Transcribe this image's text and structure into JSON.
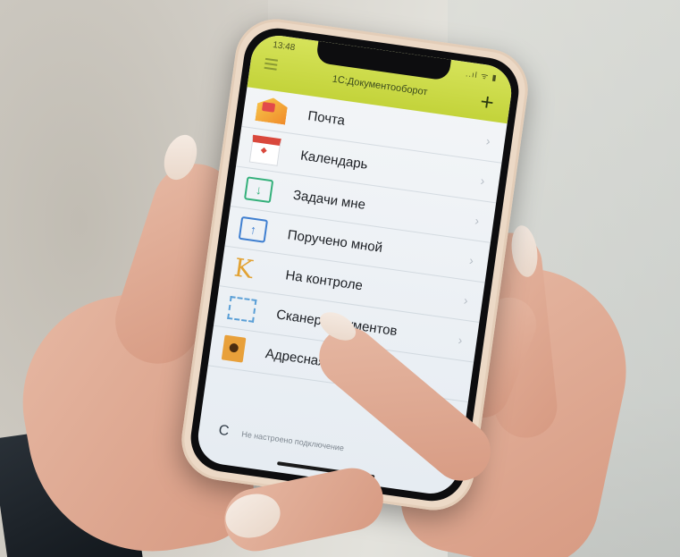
{
  "status_bar": {
    "time": "13:48",
    "icons": "..ıl ᯤ ▮"
  },
  "app": {
    "title": "1С:Документооборот",
    "add_symbol": "+"
  },
  "menu_items": [
    {
      "label": "Почта",
      "icon": "mail-icon"
    },
    {
      "label": "Календарь",
      "icon": "calendar-icon"
    },
    {
      "label": "Задачи мне",
      "icon": "arrow-down-box-icon"
    },
    {
      "label": "Поручено мной",
      "icon": "arrow-up-box-icon"
    },
    {
      "label": "На контроле",
      "icon": "k-letter-icon"
    },
    {
      "label": "Сканер документов",
      "icon": "scanner-frame-icon"
    },
    {
      "label": "Адресная кн",
      "icon": "address-book-icon"
    }
  ],
  "footer": {
    "refresh_symbol": "C",
    "status_text": "Не настроено подключение"
  },
  "icon_glyphs": {
    "down": "↓",
    "up": "↑",
    "k": "K",
    "chevron": "›"
  },
  "colors": {
    "appbar": "#c3d33a",
    "accent_green": "#34b07a",
    "accent_blue": "#3f7fd0",
    "accent_orange": "#e2a233"
  }
}
